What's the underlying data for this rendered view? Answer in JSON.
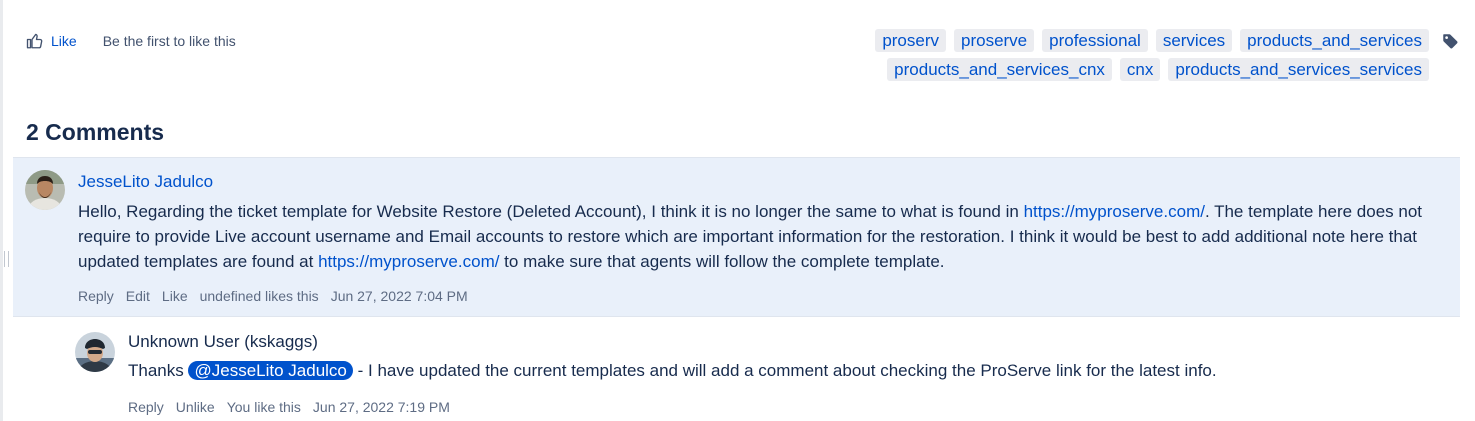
{
  "like_bar": {
    "like_label": "Like",
    "like_hint": "Be the first to like this"
  },
  "labels": {
    "row1": [
      "proserv",
      "proserve",
      "professional",
      "services",
      "products_and_services"
    ],
    "row2": [
      "products_and_services_cnx",
      "cnx",
      "products_and_services_services"
    ],
    "icon": "tag-icon"
  },
  "comments_heading": "2 Comments",
  "comments": [
    {
      "author": "JesseLito Jadulco",
      "body_parts": {
        "p1": "Hello, Regarding the ticket template for Website Restore (Deleted Account), I think it is no longer the same to what is found in ",
        "link1": "https://myproserve.com/",
        "p2": ". The template here does not require to provide Live account username and Email accounts to restore which are important information for the restoration. I think it would be best to add additional note here that updated templates are found at ",
        "link2": "https://myproserve.com/",
        "p3": " to make sure that agents will follow the complete template."
      },
      "actions": {
        "reply": "Reply",
        "edit": "Edit",
        "like": "Like",
        "likes_text": "undefined likes this",
        "timestamp": "Jun 27, 2022 7:04 PM"
      }
    },
    {
      "author": "Unknown User (kskaggs)",
      "body_parts": {
        "p1": "Thanks ",
        "mention": "@JesseLito Jadulco",
        "p2": " - I have updated the current templates and will add a comment about checking the ProServe link for the latest info."
      },
      "actions": {
        "reply": "Reply",
        "unlike": "Unlike",
        "likes_text": "You like this",
        "timestamp": "Jun 27, 2022 7:19 PM"
      }
    }
  ],
  "colors": {
    "link": "#0052cc",
    "comment_highlight": "#e9f0fa",
    "label_bg": "#ebecf0"
  }
}
